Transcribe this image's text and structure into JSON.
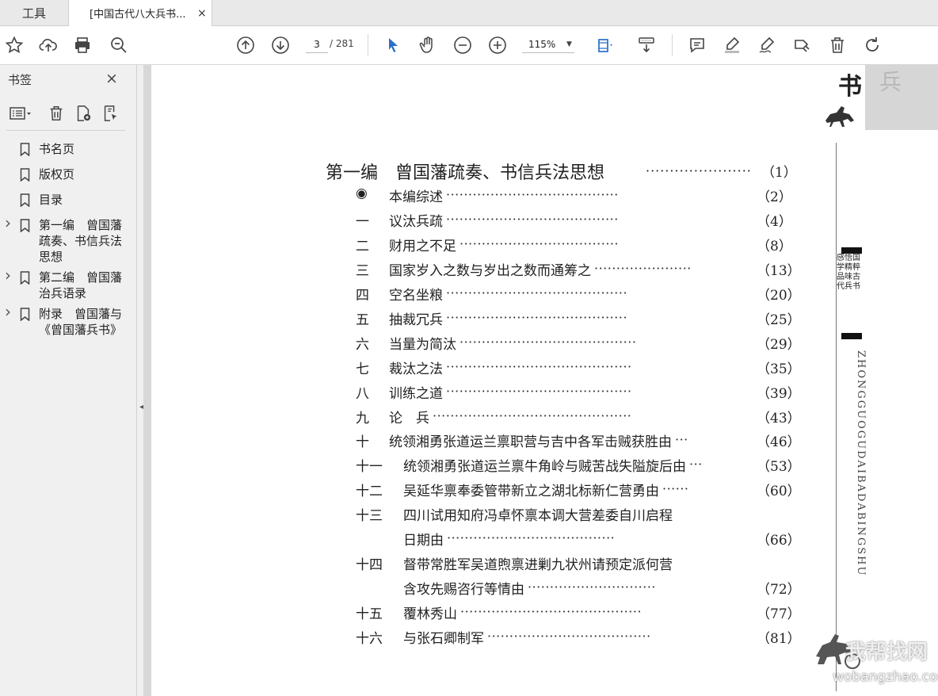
{
  "tabs": {
    "tools_label": "工具",
    "doc_title": "[中国古代八大兵书...",
    "close_glyph": "×"
  },
  "toolbar": {
    "current_page": "3",
    "total_pages": "/ 281",
    "zoom": "115%"
  },
  "sidebar": {
    "title": "书签",
    "close_glyph": "×",
    "bookmarks": [
      {
        "label": "书名页",
        "expandable": false
      },
      {
        "label": "版权页",
        "expandable": false
      },
      {
        "label": "目录",
        "expandable": false
      },
      {
        "label": "第一编　曾国藩疏奏、书信兵法思想",
        "expandable": true
      },
      {
        "label": "第二编　曾国藩治兵语录",
        "expandable": true
      },
      {
        "label": "附录　曾国藩与《曾国藩兵书》",
        "expandable": true
      }
    ]
  },
  "document": {
    "section_title": "第一编　曾国藩疏奏、书信兵法思想",
    "section_dots": "······················",
    "section_page": "（1）",
    "entries": [
      {
        "num": "◉",
        "text": "本编综述",
        "dots": "·······································",
        "page": "（2）"
      },
      {
        "num": "一",
        "text": "议汰兵疏",
        "dots": "·······································",
        "page": "（4）"
      },
      {
        "num": "二",
        "text": "财用之不足",
        "dots": "····································",
        "page": "（8）"
      },
      {
        "num": "三",
        "text": "国家岁入之数与岁出之数而通筹之",
        "dots": "······················",
        "page": "（13）"
      },
      {
        "num": "四",
        "text": "空名坐粮",
        "dots": "·········································",
        "page": "（20）"
      },
      {
        "num": "五",
        "text": "抽裁冗兵",
        "dots": "·········································",
        "page": "（25）"
      },
      {
        "num": "六",
        "text": "当量为简汰",
        "dots": "········································",
        "page": "（29）"
      },
      {
        "num": "七",
        "text": "裁汰之法",
        "dots": "··········································",
        "page": "（35）"
      },
      {
        "num": "八",
        "text": "训练之道",
        "dots": "··········································",
        "page": "（39）"
      },
      {
        "num": "九",
        "text": "论　兵",
        "dots": "·············································",
        "page": "（43）"
      },
      {
        "num": "十",
        "text": "统领湘勇张道运兰禀职营与吉中各军击贼获胜由",
        "dots": "···",
        "page": "（46）"
      },
      {
        "num": "十一",
        "text": "统领湘勇张道运兰禀牛角岭与贼苦战失隘旋后由",
        "dots": "···",
        "page": "（53）"
      },
      {
        "num": "十二",
        "text": "吴延华禀奉委管带新立之湖北标新仁营勇由",
        "dots": "······",
        "page": "（60）"
      },
      {
        "num": "十三",
        "text": "四川试用知府冯卓怀禀本调大营差委自川启程",
        "dots": "",
        "page": ""
      },
      {
        "num": "",
        "text": "日期由",
        "dots": "······································",
        "page": "（66）"
      },
      {
        "num": "十四",
        "text": "督带常胜军吴道煦禀进剿九状州请预定派何营",
        "dots": "",
        "page": ""
      },
      {
        "num": "",
        "text": "含攻先赐咨行等情由",
        "dots": "·····························",
        "page": "（72）"
      },
      {
        "num": "十五",
        "text": "覆林秀山",
        "dots": "·········································",
        "page": "（77）"
      },
      {
        "num": "十六",
        "text": "与张石卿制军",
        "dots": "·····································",
        "page": "（81）"
      }
    ]
  },
  "spine": {
    "big_char": "书",
    "gray_char": "兵",
    "vertical_cn": "感悟国学精粹 品味古代兵书",
    "roman": "ZHONGGUOGUDAIBADABINGSHU"
  },
  "watermark": {
    "top": "我帮找网",
    "bottom": "wobangzhao.com"
  }
}
